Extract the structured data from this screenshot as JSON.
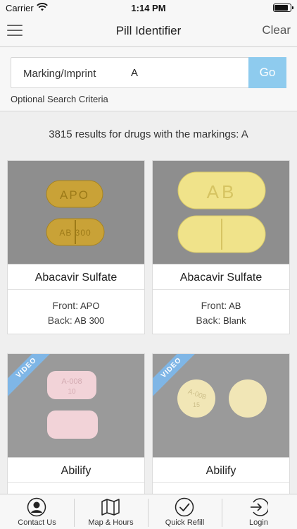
{
  "status_bar": {
    "carrier": "Carrier",
    "time": "1:14 PM",
    "battery_level": 0.9
  },
  "nav": {
    "title": "Pill Identifier",
    "clear_label": "Clear"
  },
  "search": {
    "field_label": "Marking/Imprint",
    "value": "A",
    "go_label": "Go",
    "optional_label": "Optional Search Criteria"
  },
  "results": {
    "header": "3815 results for drugs with the markings: A"
  },
  "cards": [
    {
      "name": "Abacavir Sulfate",
      "front_label": "Front:",
      "front": "APO",
      "back_label": "Back:",
      "back": "AB 300",
      "video": false,
      "imprints": [
        "APO",
        "AB 300"
      ]
    },
    {
      "name": "Abacavir Sulfate",
      "front_label": "Front:",
      "front": "AB",
      "back_label": "Back:",
      "back": "Blank",
      "video": false,
      "imprints": [
        "AB"
      ]
    },
    {
      "name": "Abilify",
      "video": true,
      "video_label": "VIDEO",
      "imprints": [
        "A-008",
        "10"
      ]
    },
    {
      "name": "Abilify",
      "video": true,
      "video_label": "VIDEO",
      "imprints": [
        "A-008",
        "15"
      ]
    }
  ],
  "tabs": [
    {
      "label": "Contact Us",
      "icon": "person-icon"
    },
    {
      "label": "Map & Hours",
      "icon": "map-icon"
    },
    {
      "label": "Quick Refill",
      "icon": "checkmark-icon"
    },
    {
      "label": "Login",
      "icon": "login-icon"
    }
  ],
  "colors": {
    "accent": "#8ecbee",
    "ribbon": "#7fb6e6",
    "photo_bg": "#8e8e8e",
    "nav_bg": "#f7f7f7"
  }
}
